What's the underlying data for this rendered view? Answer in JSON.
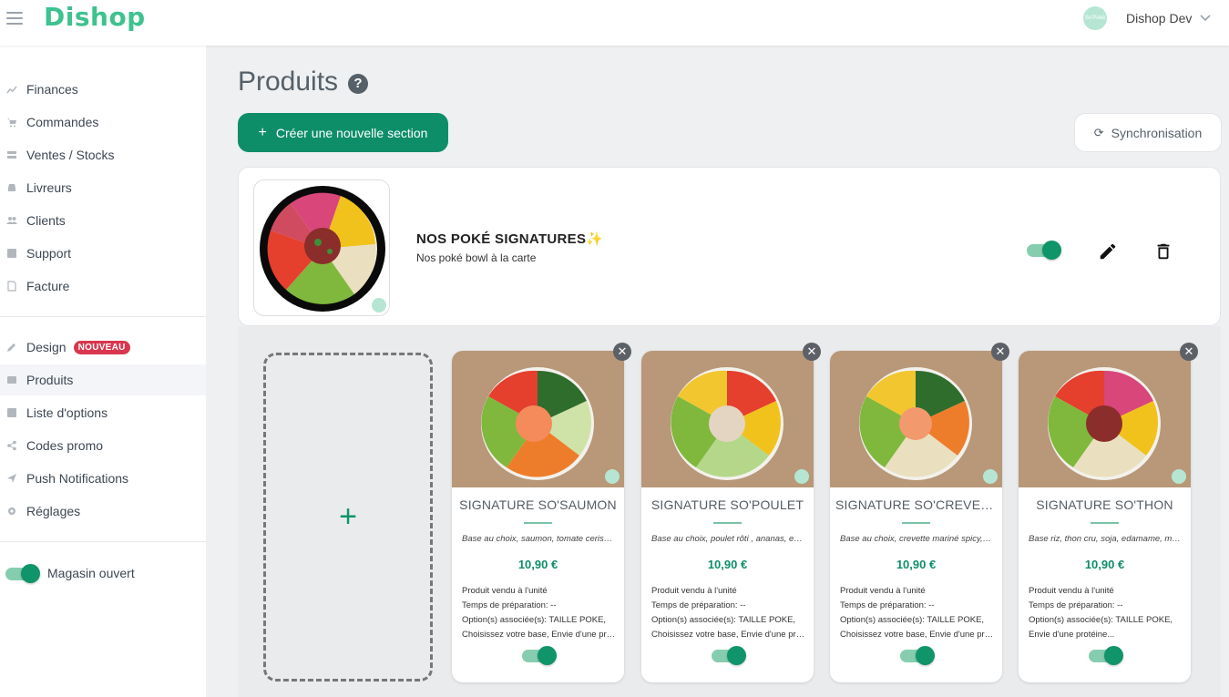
{
  "app": {
    "logo": "Dishop",
    "user_name": "Dishop Dev",
    "avatar_text": "So'Poké"
  },
  "sidebar": {
    "items": [
      {
        "label": "Finances",
        "icon": "chart-line-icon"
      },
      {
        "label": "Commandes",
        "icon": "cart-icon"
      },
      {
        "label": "Ventes / Stocks",
        "icon": "stock-icon"
      },
      {
        "label": "Livreurs",
        "icon": "car-icon"
      },
      {
        "label": "Clients",
        "icon": "users-icon"
      },
      {
        "label": "Support",
        "icon": "support-icon"
      },
      {
        "label": "Facture",
        "icon": "file-icon"
      }
    ],
    "items2": [
      {
        "label": "Design",
        "icon": "pencil-icon",
        "badge": "NOUVEAU"
      },
      {
        "label": "Produits",
        "icon": "product-icon",
        "active": true
      },
      {
        "label": "Liste d'options",
        "icon": "list-add-icon"
      },
      {
        "label": "Codes promo",
        "icon": "share-icon"
      },
      {
        "label": "Push Notifications",
        "icon": "send-icon"
      },
      {
        "label": "Réglages",
        "icon": "gear-icon"
      }
    ],
    "store_label": "Magasin ouvert"
  },
  "main": {
    "title": "Produits",
    "help": "?",
    "new_section_label": "Créer une nouvelle section",
    "sync_label": "Synchronisation"
  },
  "section": {
    "title": "NOS POKÉ SIGNATURES✨",
    "subtitle": "Nos poké bowl à la carte",
    "enabled": true
  },
  "products": [
    {
      "name": "SIGNATURE SO'SAUMON",
      "desc": "Base au choix, saumon, tomate cerise, edamame",
      "price": "10,90 €",
      "info": [
        "Produit vendu à l'unité",
        "Temps de préparation: --",
        "Option(s) associée(s): TAILLE POKE,",
        "Choisissez votre base, Envie d'une protéine"
      ]
    },
    {
      "name": "SIGNATURE SO'POULET",
      "desc": "Base au choix, poulet rôti , ananas, edamame",
      "price": "10,90 €",
      "info": [
        "Produit vendu à l'unité",
        "Temps de préparation: --",
        "Option(s) associée(s): TAILLE POKE,",
        "Choisissez votre base, Envie d'une protéine"
      ]
    },
    {
      "name": "SIGNATURE SO'CREVETTE",
      "desc": "Base au choix, crevette mariné spicy, mangue",
      "price": "10,90 €",
      "info": [
        "Produit vendu à l'unité",
        "Temps de préparation: --",
        "Option(s) associée(s): TAILLE POKE,",
        "Choisissez votre base, Envie d'une protéine"
      ]
    },
    {
      "name": "SIGNATURE SO'THON",
      "desc": "Base riz, thon cru, soja, edamame, maïs",
      "price": "10,90 €",
      "info": [
        "Produit vendu à l'unité",
        "Temps de préparation: --",
        "Option(s) associée(s): TAILLE POKE,",
        "Envie d'une protéine..."
      ]
    }
  ]
}
